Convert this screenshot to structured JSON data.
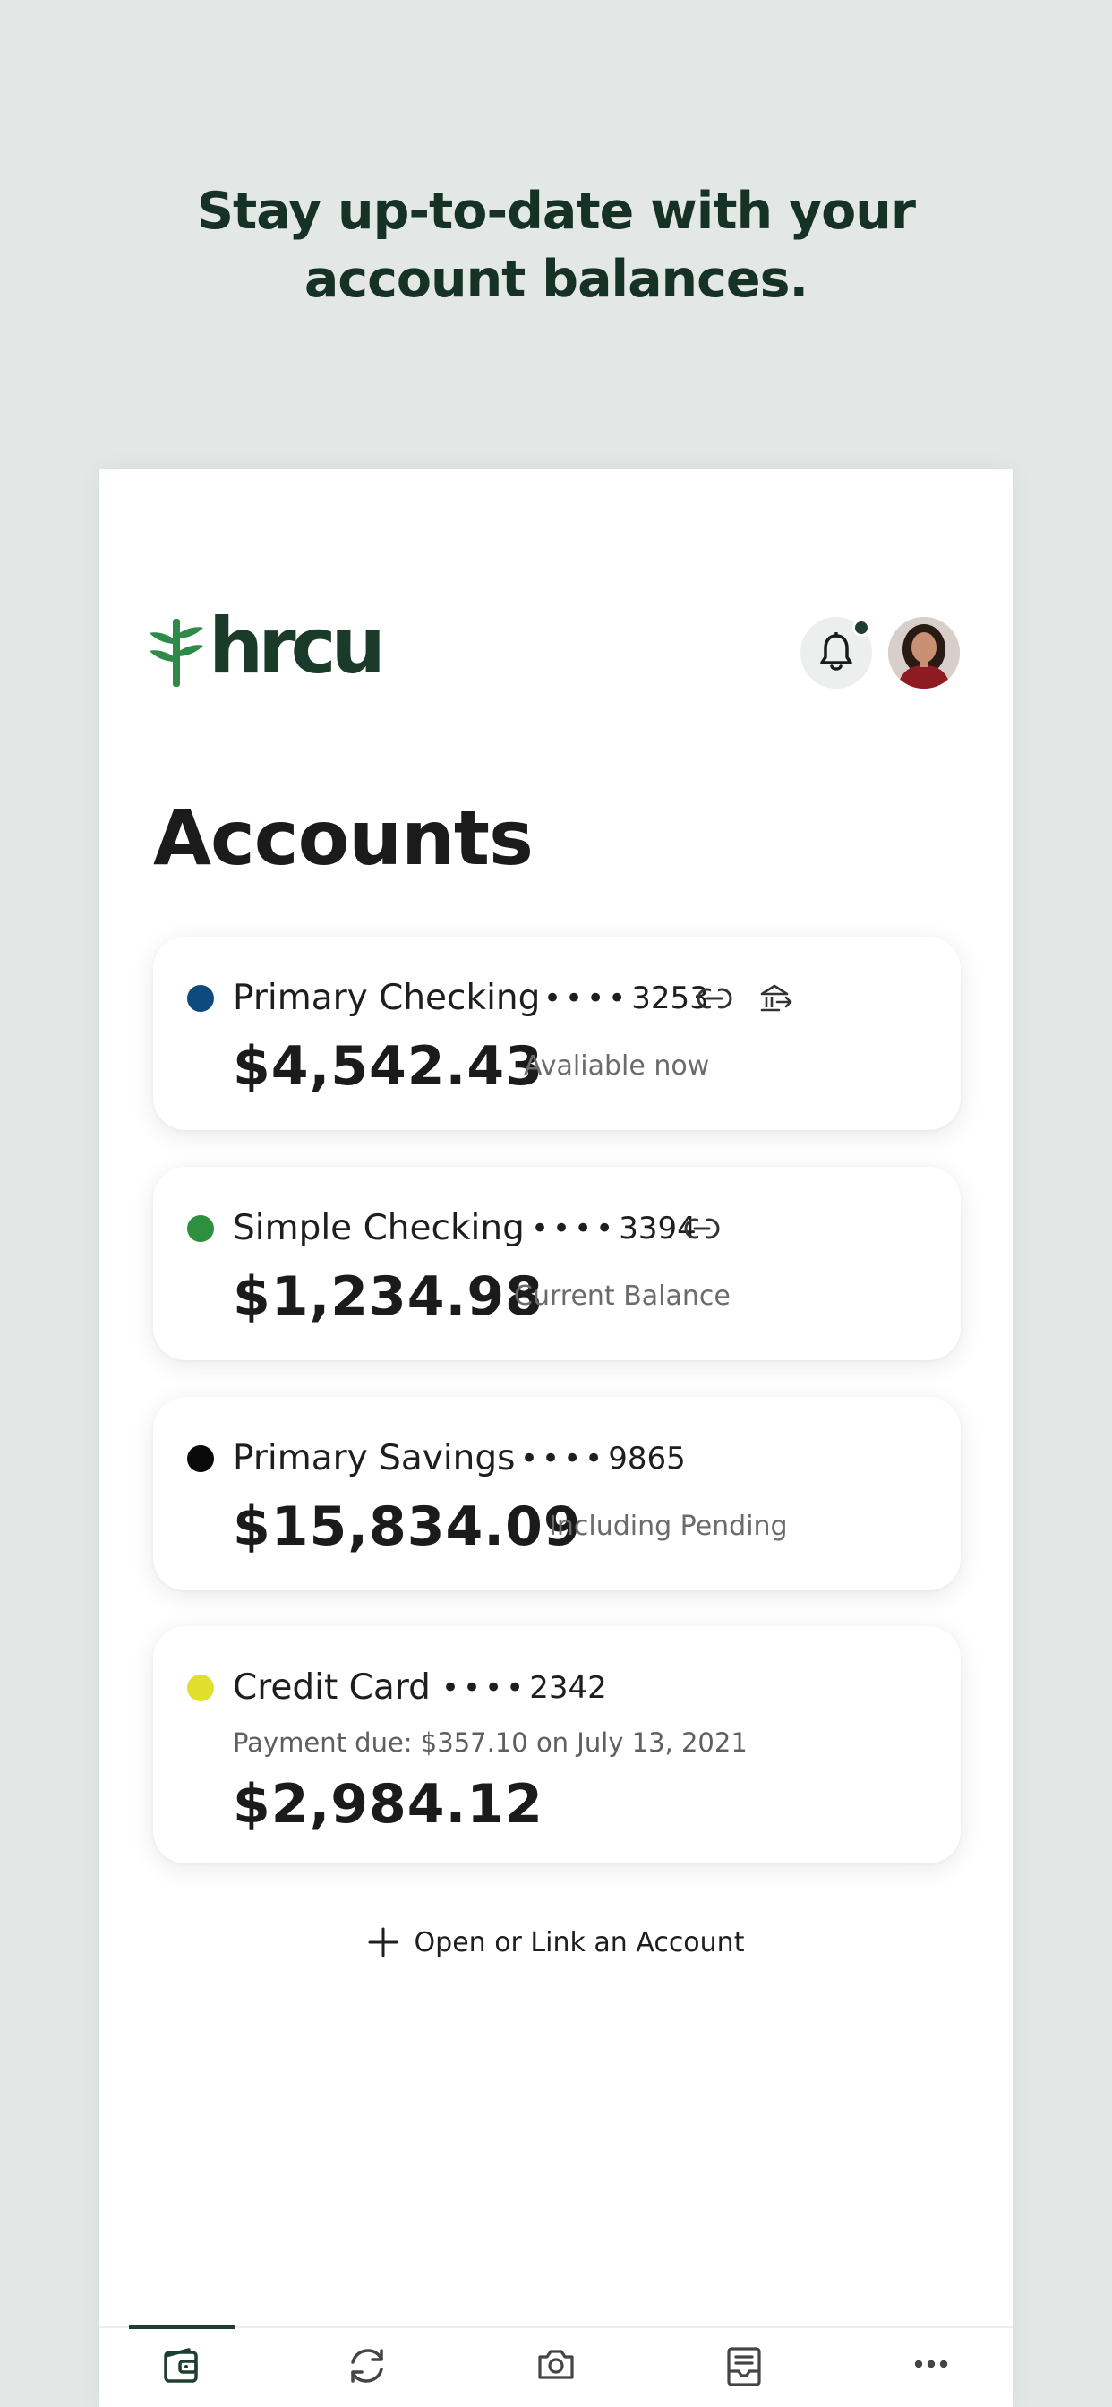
{
  "promo": {
    "line1": "Stay up-to-date with your",
    "line2": "account balances."
  },
  "header": {
    "logo_text": "hrcu",
    "logo_icon": "wheat-sprout-icon",
    "notification_icon": "bell-icon",
    "has_unread_notifications": true,
    "avatar": "user-avatar"
  },
  "page": {
    "title": "Accounts"
  },
  "accounts": [
    {
      "name": "Primary Checking",
      "mask": "••••",
      "last4": "3253",
      "balance": "$4,542.43",
      "label": "Avaliable now",
      "color": "#0e4a7e",
      "icons": [
        "link-icon",
        "bank-transfer-icon"
      ]
    },
    {
      "name": "Simple Checking",
      "mask": "••••",
      "last4": "3394",
      "balance": "$1,234.98",
      "label": "Current Balance",
      "color": "#2e8f3e",
      "icons": [
        "link-icon"
      ]
    },
    {
      "name": "Primary Savings",
      "mask": "••••",
      "last4": "9865",
      "balance": "$15,834.09",
      "label": "Including Pending",
      "color": "#0a0a0a",
      "icons": []
    },
    {
      "name": "Credit Card",
      "mask": "••••",
      "last4": "2342",
      "payment_due": "Payment due: $357.10 on July 13, 2021",
      "balance": "$2,984.12",
      "color": "#e2de2e",
      "icons": []
    }
  ],
  "actions": {
    "open_link_label": "Open or Link an Account",
    "open_link_icon": "plus-icon"
  },
  "tabbar": {
    "active": "accounts",
    "tabs": [
      {
        "id": "accounts",
        "icon": "wallet-icon"
      },
      {
        "id": "transfers",
        "icon": "refresh-transfer-icon"
      },
      {
        "id": "deposit",
        "icon": "camera-icon"
      },
      {
        "id": "messages",
        "icon": "inbox-icon"
      },
      {
        "id": "more",
        "icon": "more-dots-icon"
      }
    ]
  },
  "colors": {
    "background": "#e3e7e5",
    "brand_dark": "#1a3a2a",
    "brand_green": "#2f8a4a"
  }
}
